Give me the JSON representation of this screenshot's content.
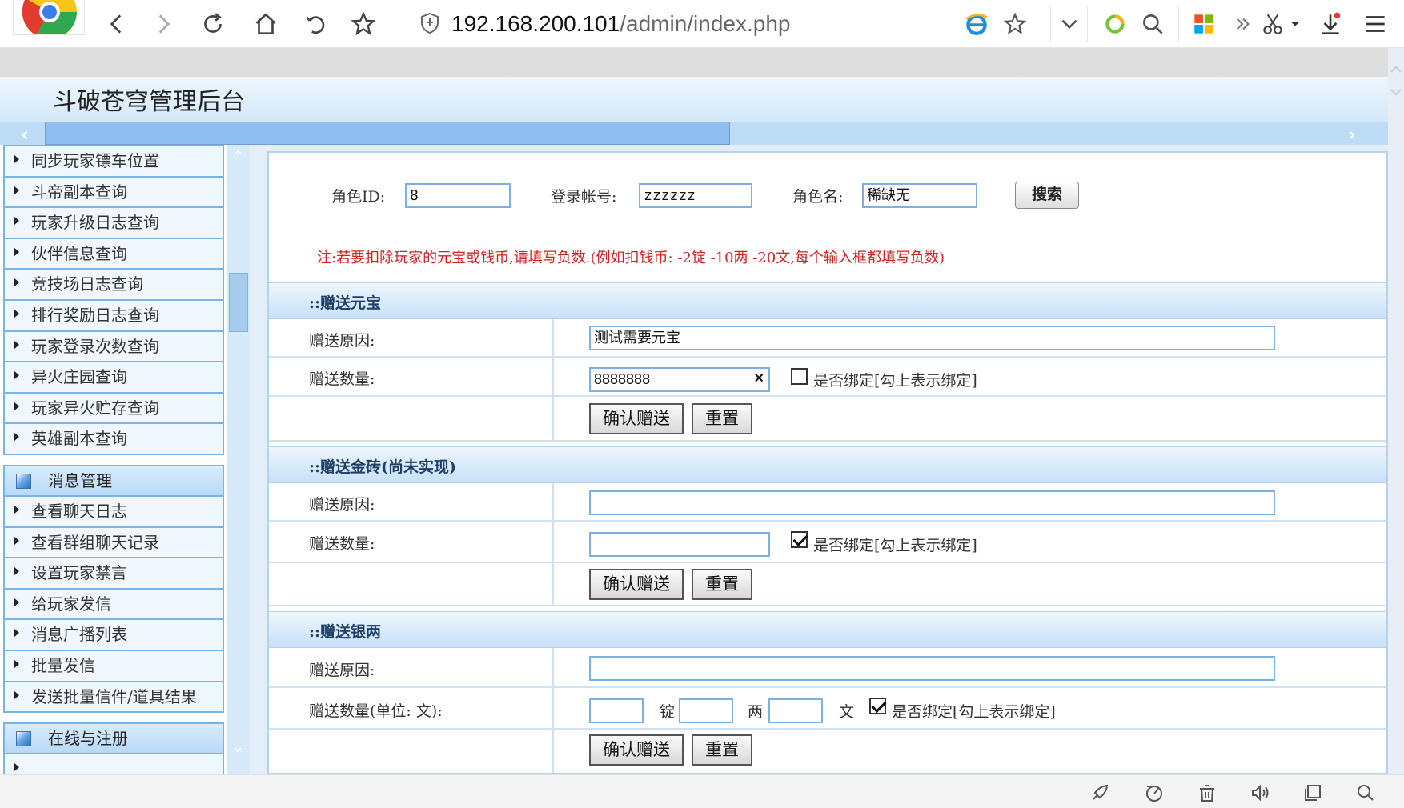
{
  "browser": {
    "url_host": "192.168.200.101",
    "url_path": "/admin/index.php"
  },
  "header": {
    "title": "斗破苍穹管理后台"
  },
  "sidebar": {
    "items_top": [
      {
        "label": "同步玩家镖车位置"
      },
      {
        "label": "斗帝副本查询"
      },
      {
        "label": "玩家升级日志查询"
      },
      {
        "label": "伙伴信息查询"
      },
      {
        "label": "竞技场日志查询"
      },
      {
        "label": "排行奖励日志查询"
      },
      {
        "label": "玩家登录次数查询"
      },
      {
        "label": "异火庄园查询"
      },
      {
        "label": "玩家异火贮存查询"
      },
      {
        "label": "英雄副本查询"
      }
    ],
    "group_message": "消息管理",
    "items_message": [
      {
        "label": "查看聊天日志"
      },
      {
        "label": "查看群组聊天记录"
      },
      {
        "label": "设置玩家禁言"
      },
      {
        "label": "给玩家发信"
      },
      {
        "label": "消息广播列表"
      },
      {
        "label": "批量发信"
      },
      {
        "label": "发送批量信件/道具结果"
      }
    ],
    "group_online": "在线与注册"
  },
  "search": {
    "role_id_label": "角色ID:",
    "role_id_value": "8",
    "account_label": "登录帐号:",
    "account_value": "zzzzzz",
    "role_name_label": "角色名:",
    "role_name_value": "稀缺无",
    "search_button": "搜索"
  },
  "note": "注:若要扣除玩家的元宝或钱币,请填写负数.(例如扣钱币: -2锭 -10两 -20文,每个输入框都填写负数)",
  "sections": {
    "yuanbao": {
      "title": "::赠送元宝",
      "reason_label": "赠送原因:",
      "reason_value": "测试需要元宝",
      "amount_label": "赠送数量:",
      "amount_value": "8888888",
      "clear": "×",
      "bind_label": "是否绑定[勾上表示绑定]",
      "bind_checked": false,
      "confirm": "确认赠送",
      "reset": "重置"
    },
    "gold": {
      "title": "::赠送金砖(尚未实现)",
      "reason_label": "赠送原因:",
      "reason_value": "",
      "amount_label": "赠送数量:",
      "amount_value": "",
      "bind_label": "是否绑定[勾上表示绑定]",
      "bind_checked": true,
      "confirm": "确认赠送",
      "reset": "重置"
    },
    "silver": {
      "title": "::赠送银两",
      "reason_label": "赠送原因:",
      "reason_value": "",
      "amount_label": "赠送数量(单位: 文):",
      "unit_ding": "锭",
      "unit_liang": "两",
      "unit_wen": "文",
      "bind_label": "是否绑定[勾上表示绑定]",
      "bind_checked": true,
      "confirm": "确认赠送",
      "reset": "重置"
    }
  }
}
